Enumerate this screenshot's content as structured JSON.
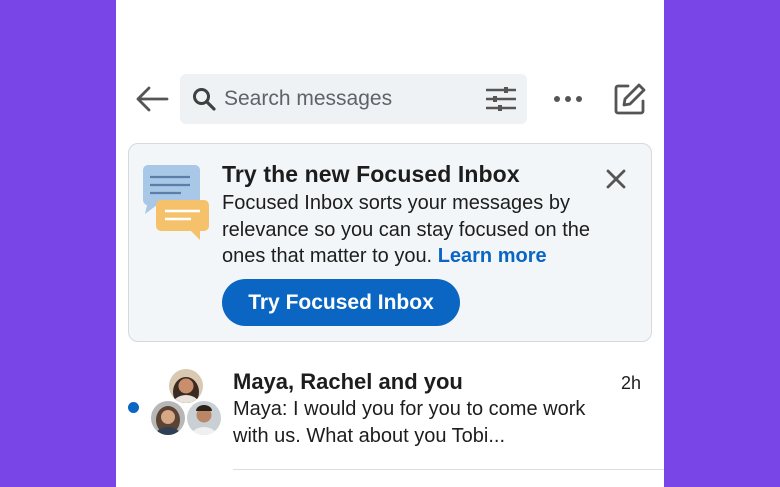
{
  "search": {
    "placeholder": "Search messages"
  },
  "icons": {
    "back": "arrow-left-icon",
    "search": "search-icon",
    "filter": "sliders-icon",
    "more": "more-horizontal-icon",
    "compose": "compose-icon",
    "close": "close-icon",
    "illustration": "chat-bubbles-icon"
  },
  "banner": {
    "title": "Try the new Focused Inbox",
    "body": "Focused Inbox sorts your messages by relevance so you can stay focused on the ones that matter to you.",
    "learn_more": "Learn more",
    "cta_label": "Try Focused Inbox"
  },
  "thread": {
    "names": "Maya, Rachel and you",
    "time": "2h",
    "preview": "Maya: I would you for you to come work with us. What about you Tobi..."
  },
  "colors": {
    "background": "#7a45e6",
    "accent": "#0a66c2",
    "banner_bg": "#f3f6f8",
    "search_bg": "#eef2f5",
    "illus_blue": "#a9c7e6",
    "illus_orange": "#f5c26b"
  }
}
